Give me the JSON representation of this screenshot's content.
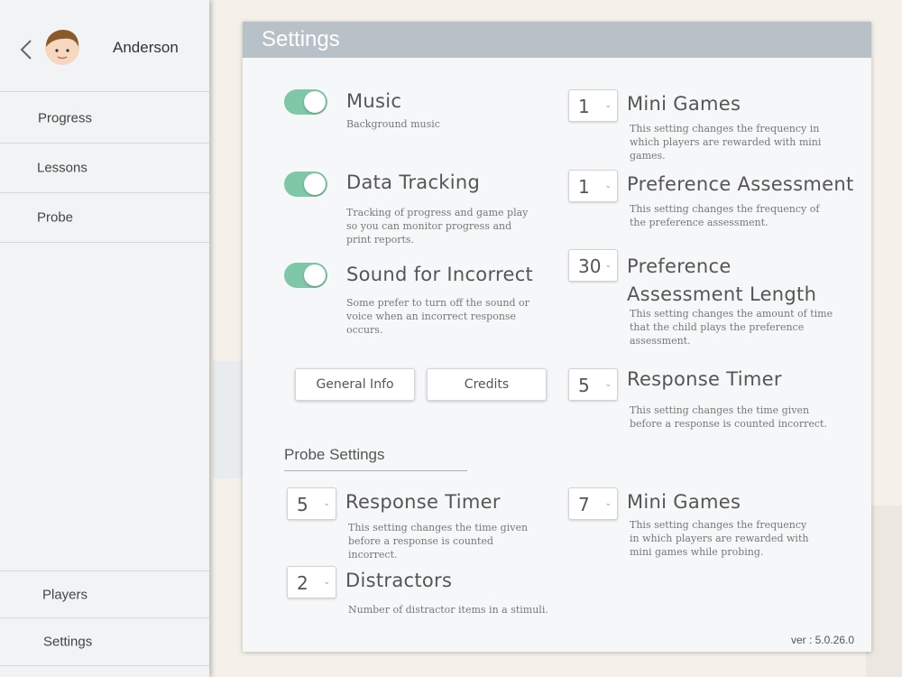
{
  "sidebar": {
    "profile_name": "Anderson",
    "nav_top": [
      {
        "label": "Progress"
      },
      {
        "label": "Lessons"
      },
      {
        "label": "Probe"
      }
    ],
    "nav_bottom": [
      {
        "label": "Players"
      },
      {
        "label": "Settings"
      }
    ]
  },
  "settings": {
    "title": "Settings",
    "toggles": [
      {
        "label": "Music",
        "description": "Background music",
        "on": true
      },
      {
        "label": "Data Tracking",
        "description": "Tracking of progress and game play so you can monitor progress and print reports.",
        "on": true
      },
      {
        "label": "Sound for Incorrect",
        "description": "Some prefer to turn off the sound or voice when an incorrect response occurs.",
        "on": true
      }
    ],
    "dropdowns": [
      {
        "value": "1",
        "label": "Mini Games",
        "description": "This setting changes the frequency in which players are rewarded with mini games."
      },
      {
        "value": "1",
        "label": "Preference Assessment",
        "description": "This setting changes the frequency of the preference assessment."
      },
      {
        "value": "30",
        "label": "Preference Assessment Length",
        "description": "This setting changes the amount of time that the child plays the preference assessment."
      },
      {
        "value": "5",
        "label": "Response Timer",
        "description": "This setting changes the time given before a response is counted incorrect."
      }
    ],
    "buttons": {
      "general_info": "General Info",
      "credits": "Credits"
    },
    "probe": {
      "title": "Probe Settings",
      "items": [
        {
          "value": "5",
          "label": "Response Timer",
          "description": "This setting changes the time given before a response is counted incorrect."
        },
        {
          "value": "7",
          "label": "Mini Games",
          "description": "This setting changes the frequency in which players are rewarded with mini games while probing."
        },
        {
          "value": "2",
          "label": "Distractors",
          "description": "Number of distractor items in a stimuli."
        }
      ]
    },
    "version": "ver : 5.0.26.0"
  },
  "colors": {
    "toggle_on": "#7ec7a7",
    "header": "#b9c1c8"
  },
  "icons": {
    "back": "chevron-left-icon",
    "avatar": "avatar-boy"
  }
}
